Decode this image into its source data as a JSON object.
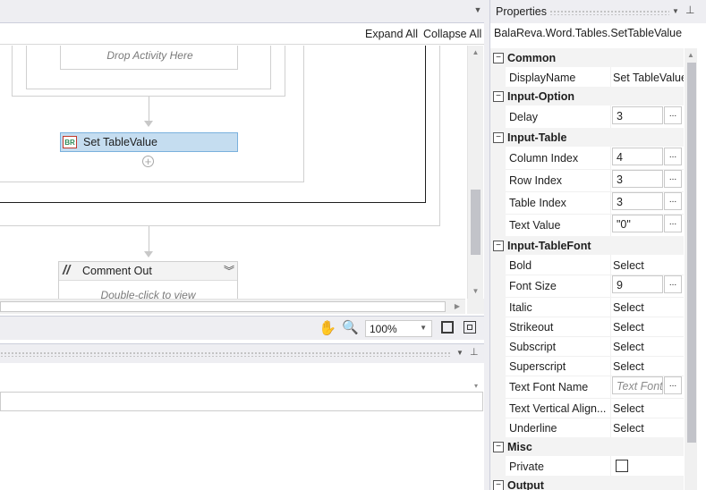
{
  "designer": {
    "expand_all": "Expand All",
    "collapse_all": "Collapse All",
    "drop_activity": "Drop Activity Here",
    "activity_label": "Set TableValue",
    "activity_icon_text": "BR",
    "comment_label": "Comment Out",
    "comment_hint": "Double-click to view",
    "zoom": "100%"
  },
  "properties": {
    "title": "Properties",
    "path": "BalaReva.Word.Tables.SetTableValue",
    "rows": [
      {
        "type": "cat",
        "label": "Common"
      },
      {
        "type": "prop",
        "name": "DisplayName",
        "value": "Set TableValue"
      },
      {
        "type": "cat",
        "label": "Input-Option"
      },
      {
        "type": "prop",
        "name": "Delay",
        "value": "3",
        "box": true
      },
      {
        "type": "cat",
        "label": "Input-Table"
      },
      {
        "type": "prop",
        "name": "Column Index",
        "value": "4",
        "box": true
      },
      {
        "type": "prop",
        "name": "Row Index",
        "value": "3",
        "box": true
      },
      {
        "type": "prop",
        "name": "Table Index",
        "value": "3",
        "box": true
      },
      {
        "type": "prop",
        "name": "Text Value",
        "value": "\"0\"",
        "box": true
      },
      {
        "type": "cat",
        "label": "Input-TableFont"
      },
      {
        "type": "prop",
        "name": "Bold",
        "value": "Select"
      },
      {
        "type": "prop",
        "name": "Font Size",
        "value": "9",
        "box": true
      },
      {
        "type": "prop",
        "name": "Italic",
        "value": "Select"
      },
      {
        "type": "prop",
        "name": "Strikeout",
        "value": "Select"
      },
      {
        "type": "prop",
        "name": "Subscript",
        "value": "Select"
      },
      {
        "type": "prop",
        "name": "Superscript",
        "value": "Select"
      },
      {
        "type": "prop",
        "name": "Text Font Name",
        "placeholder": "Text Font",
        "box": true
      },
      {
        "type": "prop",
        "name": "Text Vertical Align...",
        "value": "Select"
      },
      {
        "type": "prop",
        "name": "Underline",
        "value": "Select"
      },
      {
        "type": "cat",
        "label": "Misc"
      },
      {
        "type": "prop",
        "name": "Private",
        "checkbox": true
      },
      {
        "type": "cat",
        "label": "Output"
      }
    ]
  }
}
